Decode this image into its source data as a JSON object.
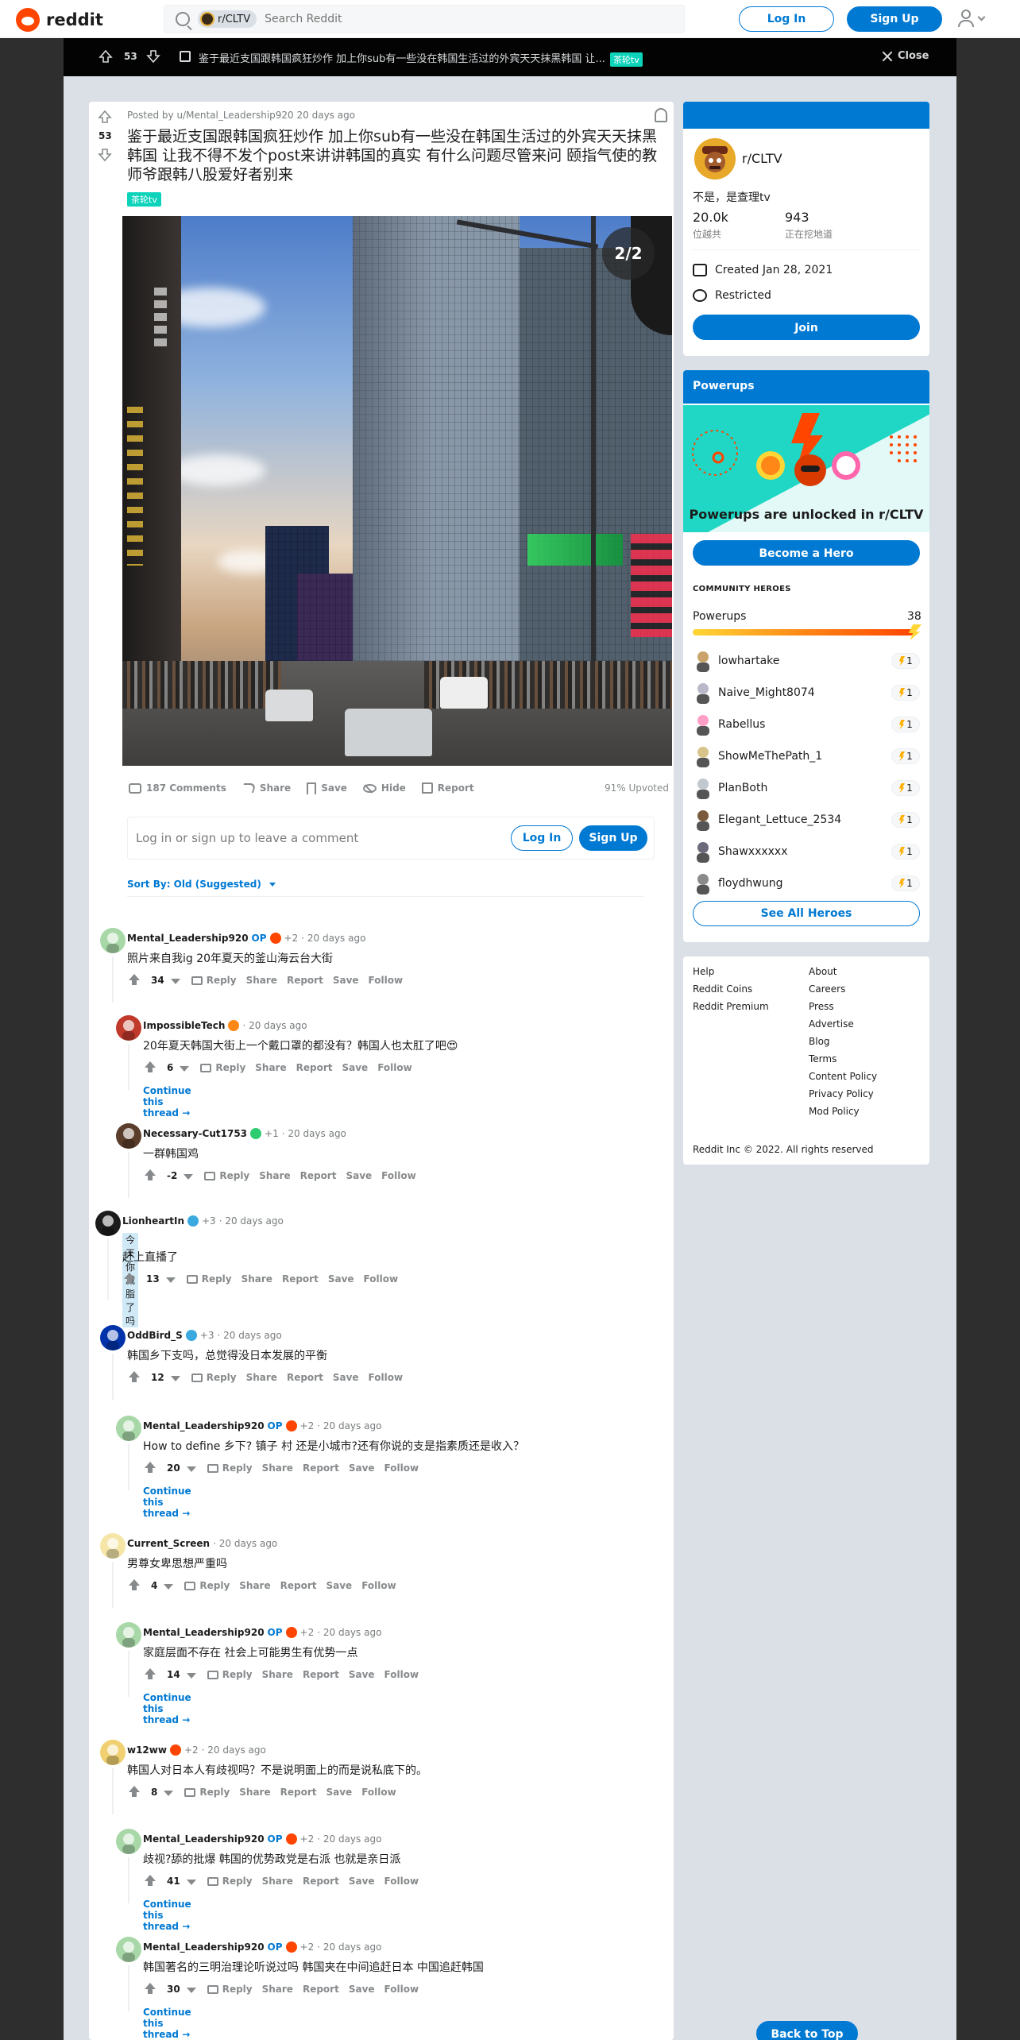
{
  "header": {
    "logo_text": "reddit",
    "search_chip": "r/CLTV",
    "search_placeholder": "Search Reddit",
    "login_label": "Log In",
    "signup_label": "Sign Up"
  },
  "postbar": {
    "votes": "53",
    "title": "鉴于最近支国跟韩国疯狂炒作 加上你sub有一些没在韩国生活过的外宾天天抹黑韩国 让...",
    "flair": "茶轮tv",
    "close_label": "Close"
  },
  "post": {
    "votes": "53",
    "meta": "Posted by u/Mental_Leadership920 20 days ago",
    "title": "鉴于最近支国跟韩国疯狂炒作 加上你sub有一些没在韩国生活过的外宾天天抹黑韩国 让我不得不发个post来讲讲韩国的真实 有什么问题尽管来问 颐指气使的教师爷跟韩八股爱好者别来",
    "flair": "茶轮tv",
    "image_counter": "2/2",
    "actions": {
      "comments": "187 Comments",
      "share": "Share",
      "save": "Save",
      "hide": "Hide",
      "report": "Report",
      "upvoted": "91% Upvoted"
    },
    "comment_prompt": "Log in or sign up to leave a comment",
    "comment_login": "Log In",
    "comment_signup": "Sign Up",
    "sort_by": "Sort By: Old (Suggested)"
  },
  "comment_actions": {
    "reply": "Reply",
    "share": "Share",
    "report": "Report",
    "save": "Save",
    "follow": "Follow",
    "continue": "Continue this thread →"
  },
  "comments": [
    {
      "author": "Mental_Leadership920",
      "op": "OP",
      "plus": "+2",
      "time": "· 20 days ago",
      "body": "照片来自我ig 20年夏天的釜山海云台大街",
      "score": "34"
    },
    {
      "author": "ImpossibleTech",
      "time": "· 20 days ago",
      "body": "20年夏天韩国大街上一个戴口罩的都没有？韩国人也太肛了吧😍",
      "score": "6"
    },
    {
      "author": "Necessary-Cut1753",
      "plus": "+1",
      "time": "· 20 days ago",
      "body": "一群韩国鸡",
      "score": "-2"
    },
    {
      "author": "LionheartIn",
      "plus": "+3",
      "time": "· 20 days ago",
      "flair": "今天你减脂了吗",
      "body": "赶上直播了",
      "score": "13"
    },
    {
      "author": "OddBird_S",
      "plus": "+3",
      "time": "· 20 days ago",
      "body": "韩国乡下支吗，总觉得没日本发展的平衡",
      "score": "12"
    },
    {
      "author": "Mental_Leadership920",
      "op": "OP",
      "plus": "+2",
      "time": "· 20 days ago",
      "body": "How to define 乡下? 镇子 村 还是小城市?还有你说的支是指素质还是收入？",
      "score": "20"
    },
    {
      "author": "Current_Screen",
      "time": "· 20 days ago",
      "body": "男尊女卑思想严重吗",
      "score": "4"
    },
    {
      "author": "Mental_Leadership920",
      "op": "OP",
      "plus": "+2",
      "time": "· 20 days ago",
      "body": "家庭层面不存在 社会上可能男生有优势一点",
      "score": "14"
    },
    {
      "author": "w12ww",
      "plus": "+2",
      "time": "· 20 days ago",
      "body": "韩国人对日本人有歧视吗？不是说明面上的而是说私底下的。",
      "score": "8"
    },
    {
      "author": "Mental_Leadership920",
      "op": "OP",
      "plus": "+2",
      "time": "· 20 days ago",
      "body": "歧视?舔的批爆 韩国的优势政党是右派 也就是亲日派",
      "score": "41"
    },
    {
      "author": "Mental_Leadership920",
      "op": "OP",
      "plus": "+2",
      "time": "· 20 days ago",
      "body": "韩国著名的三明治理论听说过吗 韩国夹在中间追赶日本 中国追赶韩国",
      "score": "30"
    }
  ],
  "sidebar": {
    "sub_name": "r/CLTV",
    "sub_desc": "不是，是查理tv",
    "members": "20.0k",
    "members_label": "位越共",
    "online": "943",
    "online_label": "正在挖地道",
    "created": "Created Jan 28, 2021",
    "restricted": "Restricted",
    "join_label": "Join"
  },
  "powerups": {
    "title": "Powerups",
    "unlocked_text": "Powerups are unlocked in r/CLTV",
    "hero_button": "Become a Hero",
    "heroes_label": "COMMUNITY HEROES",
    "powerups_label": "Powerups",
    "powerups_count": "38",
    "heroes": [
      {
        "name": "lowhartake",
        "count": "1"
      },
      {
        "name": "Naive_Might8074",
        "count": "1"
      },
      {
        "name": "Rabellus",
        "count": "1"
      },
      {
        "name": "ShowMeThePath_1",
        "count": "1"
      },
      {
        "name": "PlanBoth",
        "count": "1"
      },
      {
        "name": "Elegant_Lettuce_2534",
        "count": "1"
      },
      {
        "name": "Shawxxxxxx",
        "count": "1"
      },
      {
        "name": "floydhwung",
        "count": "1"
      }
    ],
    "see_all": "See All Heroes"
  },
  "footer": {
    "links_left": [
      "Help",
      "Reddit Coins",
      "Reddit Premium"
    ],
    "links_right": [
      "About",
      "Careers",
      "Press",
      "Advertise",
      "Blog",
      "Terms",
      "Content Policy",
      "Privacy Policy",
      "Mod Policy"
    ],
    "copyright": "Reddit Inc © 2022. All rights reserved"
  },
  "back_to_top": "Back to Top",
  "colors": {
    "brand": "#ff4500",
    "accent": "#0079d3",
    "flair": "#0dd3bb",
    "powerups_teal": "#1fd7c4"
  }
}
